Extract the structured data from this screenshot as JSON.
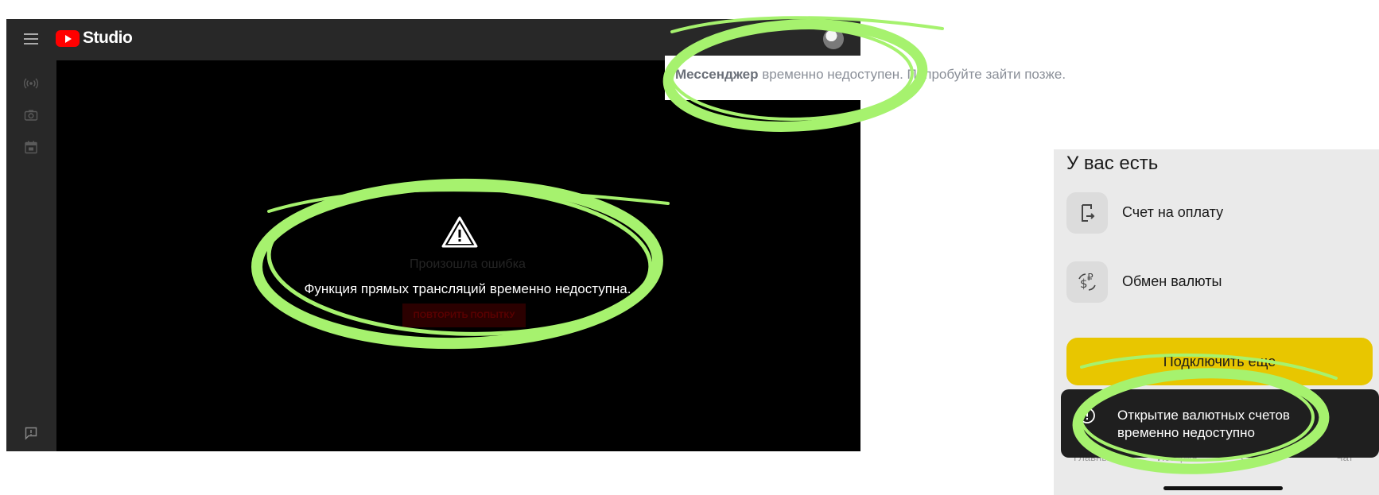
{
  "youtube": {
    "brand": "Studio",
    "icons": {
      "menu": "hamburger-menu-icon",
      "live": "live-broadcast-icon",
      "camera": "camera-icon",
      "calendar": "calendar-icon",
      "feedback": "feedback-icon",
      "warning": "warning-triangle-icon"
    },
    "error_ghost": "Произошла ошибка",
    "retry_label": "ПОВТОРИТЬ ПОПЫТКУ",
    "message": "Функция прямых трансляций временно недоступна."
  },
  "messenger": {
    "bold": "Мессенджер",
    "text": " временно недоступен. Попробуйте зайти позже."
  },
  "bank": {
    "title": "У вас есть",
    "items": [
      {
        "label": "Счет на оплату",
        "icon": "invoice-icon"
      },
      {
        "label": "Обмен валюты",
        "icon": "currency-exchange-icon"
      }
    ],
    "connect_label": "Подключить еще",
    "nav": [
      "Главный",
      "История",
      "Создать",
      "Чат"
    ],
    "toast": {
      "icon": "info-icon",
      "line1": "Открытие валютных счетов",
      "line2": "временно недоступно"
    }
  },
  "colors": {
    "annotation": "#a6f26e",
    "yt_red": "#ff0000",
    "bank_yellow": "#e8c600",
    "toast_bg": "#1f1f1f"
  }
}
